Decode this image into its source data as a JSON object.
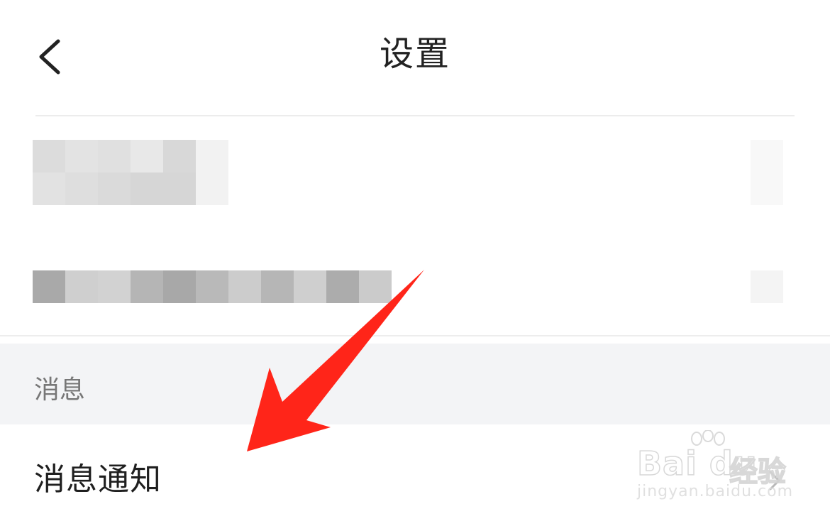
{
  "nav": {
    "title": "设置",
    "back_icon": "chevron-left-icon"
  },
  "redacted_rows": [
    {
      "left_shades": [
        "#dcdcdc",
        "#e3e3e3",
        "#e0e0e0",
        "#e8e8e8",
        "#d8d8d8",
        "#f2f2f2"
      ],
      "left_shades_b": [
        "#e2e2e2",
        "#dedede",
        "#dadada",
        "#d6d6d6",
        "#d6d6d6",
        "#f2f2f2"
      ],
      "right_shade": "#f8f8f8"
    },
    {
      "left_shades": [
        "#a9a9a9",
        "#cfcfcf",
        "#d2d2d2",
        "#b5b5b5",
        "#a8a8a8",
        "#b9b9b9",
        "#cccccc",
        "#b6b6b6",
        "#cfcfcf",
        "#acacac",
        "#cbcbcb"
      ],
      "right_shade": "#f4f4f4"
    }
  ],
  "section": {
    "header": "消息"
  },
  "rows": [
    {
      "label": "消息通知",
      "chevron_icon": "chevron-right-icon"
    }
  ],
  "watermark": {
    "logo": "Bai du",
    "jingyan": "经验",
    "url": "jingyan.baidu.com"
  },
  "annotation": {
    "arrow_color": "#ff2519"
  }
}
